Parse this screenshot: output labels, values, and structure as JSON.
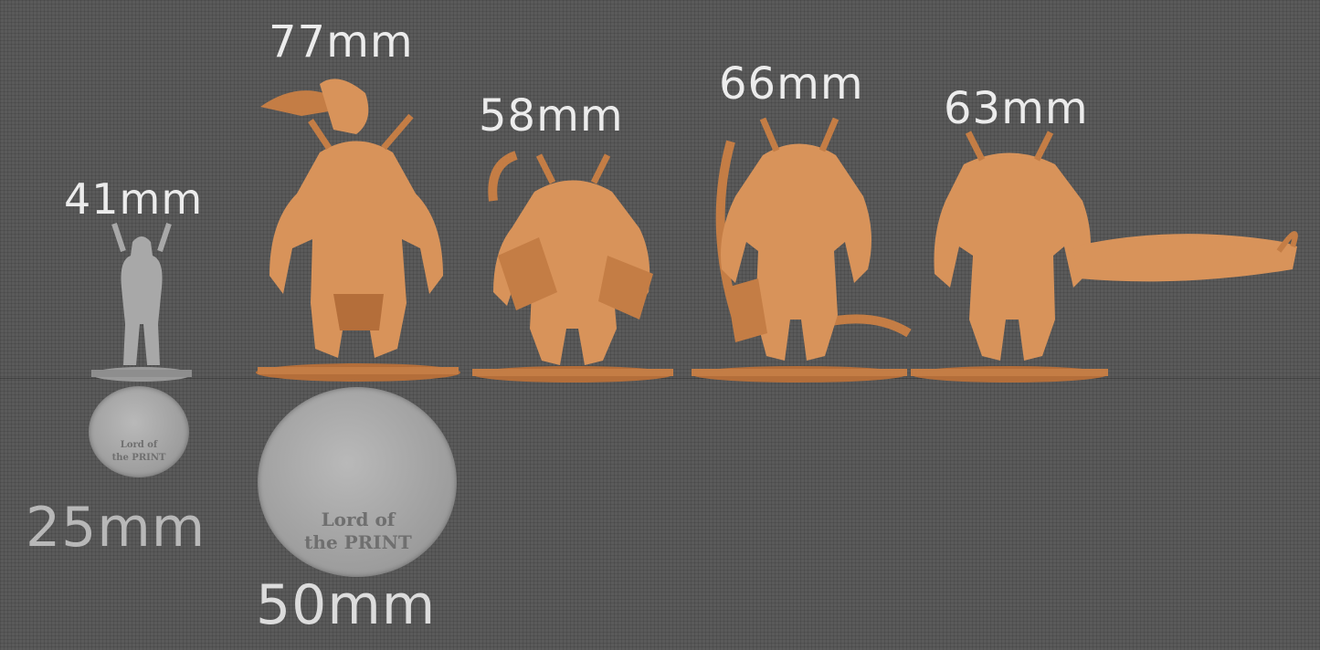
{
  "colors": {
    "background": "#5a5a5a",
    "resin": "#d8935a",
    "resin_dark": "#b46e3a",
    "grey_model": "#a8a8a8",
    "label_text": "#ececec"
  },
  "heights": {
    "human": "41mm",
    "fig1": "77mm",
    "fig2": "58mm",
    "fig3": "66mm",
    "fig4": "63mm"
  },
  "bases": {
    "small": "25mm",
    "large": "50mm"
  },
  "logo": {
    "line1": "Lord of",
    "line2": "the PRINT"
  }
}
